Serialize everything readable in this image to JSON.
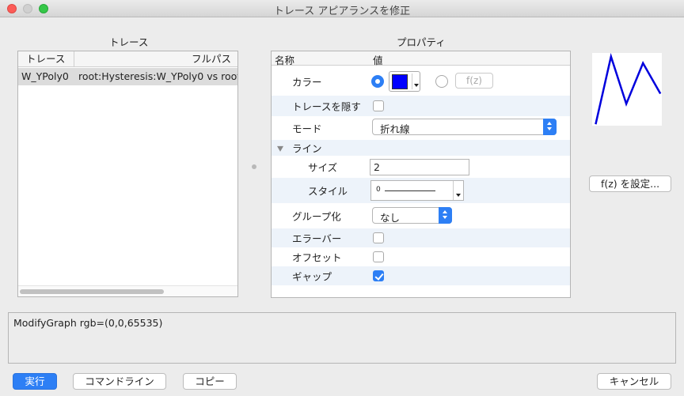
{
  "window": {
    "title": "トレース アピアランスを修正"
  },
  "traces": {
    "section_label": "トレース",
    "col_trace": "トレース",
    "col_fullpath": "フルパス",
    "rows": [
      {
        "trace": "W_YPoly0",
        "fullpath": "root:Hysteresis:W_YPoly0 vs root"
      }
    ]
  },
  "properties": {
    "section_label": "プロパティ",
    "col_name": "名称",
    "col_value": "値",
    "color_label": "カラー",
    "color_value": "#0000ff",
    "fz_inline_label": "f(z)",
    "hide_trace_label": "トレースを隠す",
    "hide_trace_checked": false,
    "mode_label": "モード",
    "mode_value": "折れ線",
    "line_group_label": "ライン",
    "size_label": "サイズ",
    "size_value": "2",
    "style_label": "スタイル",
    "style_value": "0",
    "group_label": "グループ化",
    "group_value": "なし",
    "errorbar_label": "エラーバー",
    "errorbar_checked": false,
    "offset_label": "オフセット",
    "offset_checked": false,
    "gap_label": "ギャップ",
    "gap_checked": true
  },
  "preview": {
    "line_color": "#0000dd",
    "points": [
      [
        0.05,
        0.98
      ],
      [
        0.27,
        0.05
      ],
      [
        0.49,
        0.7
      ],
      [
        0.73,
        0.14
      ],
      [
        0.98,
        0.56
      ]
    ]
  },
  "set_fz_button": "f(z) を設定...",
  "command": {
    "text": "ModifyGraph rgb=(0,0,65535)"
  },
  "buttons": {
    "execute": "実行",
    "command_line": "コマンドライン",
    "copy": "コピー",
    "cancel": "キャンセル"
  }
}
